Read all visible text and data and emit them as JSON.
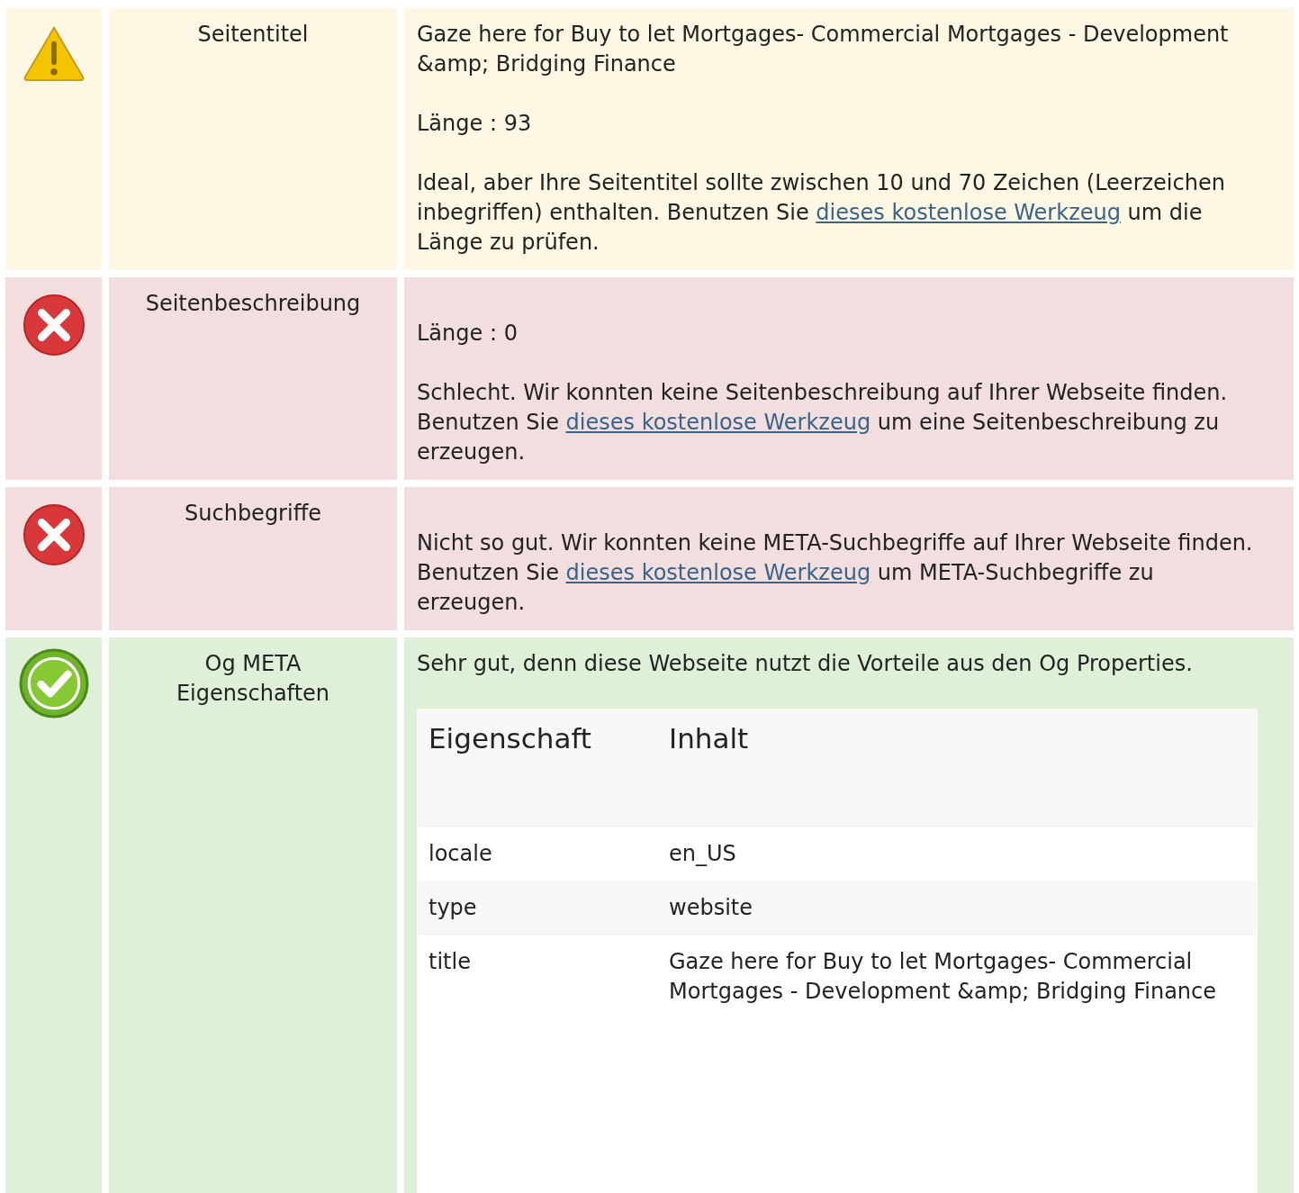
{
  "checks": [
    {
      "kind": "warning",
      "label": "Seitentitel",
      "summary": "Gaze here for Buy to let Mortgages- Commercial Mortgages - Development &amp; Bridging Finance",
      "length": "Länge : 93",
      "message": [
        {
          "text": "Ideal, aber Ihre Seitentitel sollte zwischen 10 und 70 Zeichen (Leerzeichen inbegriffen) enthalten. Benutzen Sie "
        },
        {
          "text": "dieses kostenlose Werkzeug",
          "link": true
        },
        {
          "text": " um die Länge zu prüfen."
        }
      ]
    },
    {
      "kind": "error",
      "label": "Seitenbeschreibung",
      "length": "Länge : 0",
      "message": [
        {
          "text": "Schlecht. Wir konnten keine Seitenbeschreibung auf Ihrer Webseite finden. Benutzen Sie "
        },
        {
          "text": "dieses kostenlose Werkzeug",
          "link": true
        },
        {
          "text": " um eine Seitenbeschreibung zu erzeugen."
        }
      ]
    },
    {
      "kind": "error",
      "label": "Suchbegriffe",
      "message": [
        {
          "text": "Nicht so gut. Wir konnten keine META-Suchbegriffe auf Ihrer Webseite finden. Benutzen Sie "
        },
        {
          "text": "dieses kostenlose Werkzeug",
          "link": true
        },
        {
          "text": " um META-Suchbegriffe zu erzeugen."
        }
      ]
    },
    {
      "kind": "success",
      "label": "Og META Eigenschaften",
      "summary": "Sehr gut, denn diese Webseite nutzt die Vorteile aus den Og Properties.",
      "table": {
        "columns": [
          "Eigenschaft",
          "Inhalt"
        ],
        "rows": [
          [
            "locale",
            "en_US"
          ],
          [
            "type",
            "website"
          ],
          [
            "title",
            "Gaze here for Buy to let Mortgages- Commercial Mortgages - Development &amp; Bridging Finance"
          ]
        ]
      }
    }
  ]
}
